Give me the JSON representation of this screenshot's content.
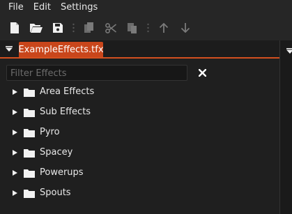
{
  "menu": {
    "items": [
      {
        "label": "File"
      },
      {
        "label": "Edit"
      },
      {
        "label": "Settings"
      }
    ]
  },
  "toolbar": {
    "buttons": [
      {
        "name": "new-file-icon"
      },
      {
        "name": "open-folder-icon"
      },
      {
        "name": "save-icon"
      },
      {
        "name": "copy-icon"
      },
      {
        "name": "cut-icon"
      },
      {
        "name": "paste-icon"
      },
      {
        "name": "move-up-icon"
      },
      {
        "name": "move-down-icon"
      }
    ]
  },
  "tabs": [
    {
      "label": "ExampleEffects.tfx",
      "active": true
    }
  ],
  "filter": {
    "placeholder": "Filter Effects",
    "value": ""
  },
  "tree": {
    "items": [
      {
        "label": "Area Effects"
      },
      {
        "label": "Sub Effects"
      },
      {
        "label": "Pyro"
      },
      {
        "label": "Spacey"
      },
      {
        "label": "Powerups"
      },
      {
        "label": "Spouts"
      }
    ]
  },
  "colors": {
    "accent": "#c9461b",
    "accent_line": "#d3501f",
    "background": "#1f1f1f",
    "bar": "#262626",
    "text": "#e8e8e8"
  }
}
